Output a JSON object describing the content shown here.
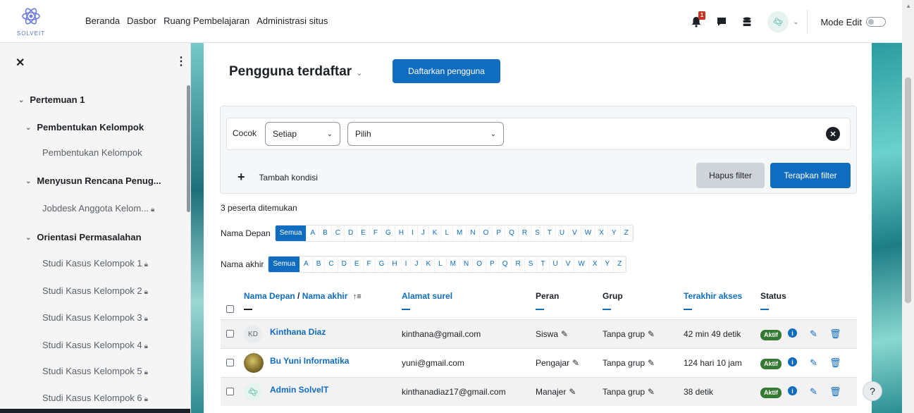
{
  "app": {
    "logo_text": "SOLVEIT"
  },
  "nav": {
    "links": [
      "Beranda",
      "Dasbor",
      "Ruang Pembelajaran",
      "Administrasi situs"
    ],
    "notification_count": "1",
    "mode_edit_label": "Mode Edit"
  },
  "drawer": {
    "items": [
      {
        "type": "section",
        "label": "Pertemuan 1",
        "indent": 0
      },
      {
        "type": "section",
        "label": "Pembentukan Kelompok",
        "indent": 1
      },
      {
        "type": "activity",
        "label": "Pembentukan Kelompok",
        "locked": false
      },
      {
        "type": "section",
        "label": "Menyusun Rencana Penug...",
        "indent": 1
      },
      {
        "type": "activity",
        "label": "Jobdesk Anggota Kelom...",
        "locked": true
      },
      {
        "type": "section",
        "label": "Orientasi Permasalahan",
        "indent": 1
      },
      {
        "type": "activity",
        "label": "Studi Kasus Kelompok 1",
        "locked": true
      },
      {
        "type": "activity",
        "label": "Studi Kasus Kelompok 2",
        "locked": true
      },
      {
        "type": "activity",
        "label": "Studi Kasus Kelompok 3",
        "locked": true
      },
      {
        "type": "activity",
        "label": "Studi Kasus Kelompok 4",
        "locked": true
      },
      {
        "type": "activity",
        "label": "Studi Kasus Kelompok 5",
        "locked": true
      },
      {
        "type": "activity",
        "label": "Studi Kasus Kelompok 6",
        "locked": true
      }
    ]
  },
  "main": {
    "title": "Pengguna terdaftar",
    "enrol_button": "Daftarkan pengguna",
    "filter": {
      "match_label": "Cocok",
      "match_value": "Setiap",
      "select_value": "Pilih",
      "add_condition": "Tambah kondisi",
      "clear_button": "Hapus filter",
      "apply_button": "Terapkan filter"
    },
    "count_text": "3 peserta ditemukan",
    "firstname_label": "Nama Depan",
    "lastname_label": "Nama akhir",
    "initials_all": "Semua",
    "letters": [
      "A",
      "B",
      "C",
      "D",
      "E",
      "F",
      "G",
      "H",
      "I",
      "J",
      "K",
      "L",
      "M",
      "N",
      "O",
      "P",
      "Q",
      "R",
      "S",
      "T",
      "U",
      "V",
      "W",
      "X",
      "Y",
      "Z"
    ],
    "table": {
      "headers": {
        "first": "Nama Depan",
        "sep": " / ",
        "last": "Nama akhir",
        "sort_icon": "↑≡",
        "email": "Alamat surel",
        "role": "Peran",
        "group": "Grup",
        "lastaccess": "Terakhir akses",
        "status": "Status"
      },
      "rows": [
        {
          "initials": "KD",
          "avatar": "initials",
          "name": "Kinthana Diaz",
          "email": "kinthana@gmail.com",
          "role": "Siswa",
          "group": "Tanpa grup",
          "lastaccess": "42 min 49 detik",
          "status": "Aktif"
        },
        {
          "initials": "",
          "avatar": "photo",
          "name": "Bu Yuni Informatika",
          "email": "yuni@gmail.com",
          "role": "Pengajar",
          "group": "Tanpa grup",
          "lastaccess": "124 hari 10 jam",
          "status": "Aktif"
        },
        {
          "initials": "",
          "avatar": "logo",
          "name": "Admin SolvelT",
          "email": "kinthanadiaz17@gmail.com",
          "role": "Manajer",
          "group": "Tanpa grup",
          "lastaccess": "38 detik",
          "status": "Aktif"
        }
      ]
    }
  },
  "help_label": "?",
  "colors": {
    "primary": "#0f6cbf",
    "success": "#357a32",
    "danger": "#ca3120"
  }
}
